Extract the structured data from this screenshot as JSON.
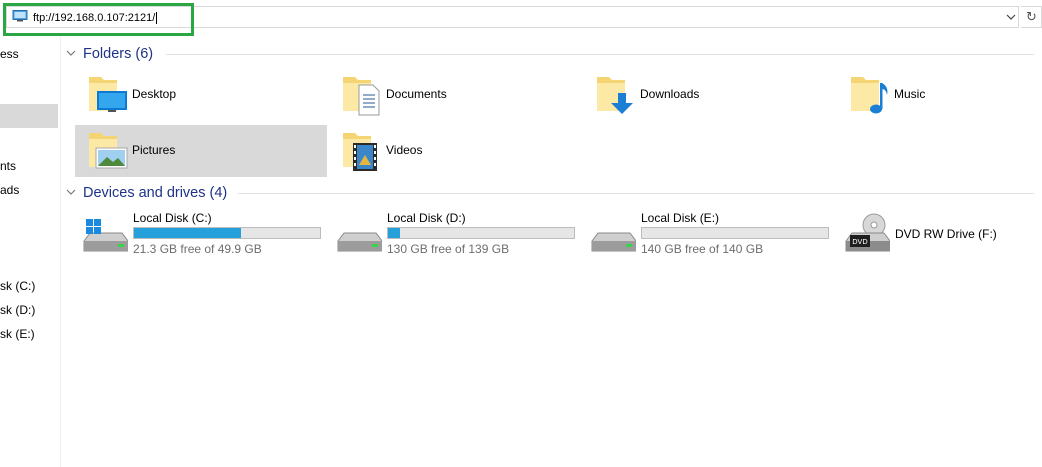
{
  "address_bar": {
    "value": "ftp://192.168.0.107:2121/",
    "refresh_icon": "refresh-icon"
  },
  "nav": {
    "items": [
      {
        "label": "ess"
      },
      {
        "label": "nts"
      },
      {
        "label": "ads"
      },
      {
        "label": "sk (C:)"
      },
      {
        "label": "sk (D:)"
      },
      {
        "label": "sk (E:)"
      }
    ]
  },
  "folders": {
    "title": "Folders (6)",
    "items": [
      {
        "label": "Desktop",
        "icon": "desktop-folder-icon"
      },
      {
        "label": "Documents",
        "icon": "documents-folder-icon"
      },
      {
        "label": "Downloads",
        "icon": "downloads-folder-icon"
      },
      {
        "label": "Music",
        "icon": "music-folder-icon"
      },
      {
        "label": "Pictures",
        "icon": "pictures-folder-icon"
      },
      {
        "label": "Videos",
        "icon": "videos-folder-icon"
      }
    ]
  },
  "devices": {
    "title": "Devices and drives (4)",
    "items": [
      {
        "name": "Local Disk (C:)",
        "free": "21.3 GB free of 49.9 GB",
        "used_fraction": 0.573,
        "icon": "windows-drive-icon"
      },
      {
        "name": "Local Disk (D:)",
        "free": "130 GB free of 139 GB",
        "used_fraction": 0.065,
        "icon": "hard-drive-icon"
      },
      {
        "name": "Local Disk (E:)",
        "free": "140 GB free of 140 GB",
        "used_fraction": 0.0,
        "icon": "hard-drive-icon"
      },
      {
        "name": "DVD RW Drive (F:)",
        "icon": "dvd-drive-icon"
      }
    ]
  },
  "colors": {
    "group_title": "#1e3287",
    "bar_fill": "#26a0da",
    "highlight_box": "#29a745",
    "selection": "#d9d9d9"
  }
}
